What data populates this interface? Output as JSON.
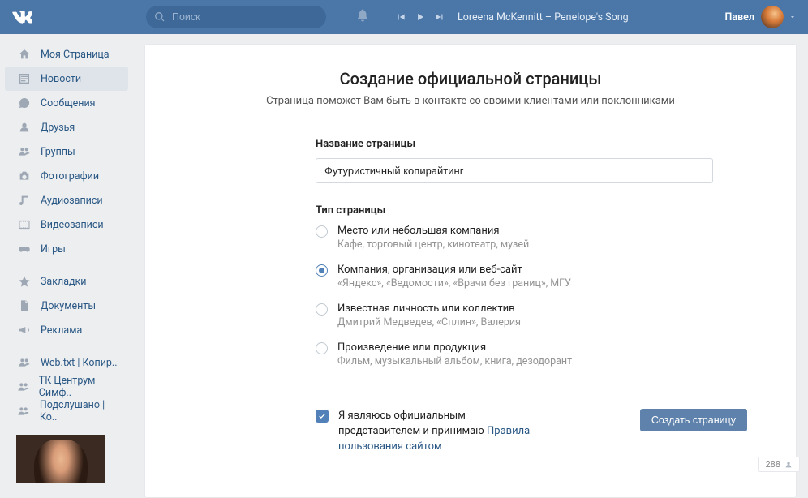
{
  "header": {
    "search_placeholder": "Поиск",
    "track": "Loreena McKennitt – Penelope's Song",
    "user_name": "Павел"
  },
  "sidebar": {
    "items": [
      {
        "label": "Моя Страница"
      },
      {
        "label": "Новости"
      },
      {
        "label": "Сообщения"
      },
      {
        "label": "Друзья"
      },
      {
        "label": "Группы"
      },
      {
        "label": "Фотографии"
      },
      {
        "label": "Аудиозаписи"
      },
      {
        "label": "Видеозаписи"
      },
      {
        "label": "Игры"
      }
    ],
    "items2": [
      {
        "label": "Закладки"
      },
      {
        "label": "Документы"
      },
      {
        "label": "Реклама"
      }
    ],
    "items3": [
      {
        "label": "Web.txt | Копир.."
      },
      {
        "label": "ТК Центрум Симф.."
      },
      {
        "label": "Подслушано | Ко.."
      }
    ]
  },
  "main": {
    "title": "Создание официальной страницы",
    "subtitle": "Страница поможет Вам быть в контакте со своими клиентами или поклонниками",
    "name_label": "Название страницы",
    "name_value": "Футуристичный копирайтинг",
    "type_label": "Тип страницы",
    "options": [
      {
        "title": "Место или небольшая компания",
        "desc": "Кафе, торговый центр, кинотеатр, музей"
      },
      {
        "title": "Компания, организация или веб-сайт",
        "desc": "«Яндекс», «Ведомости», «Врачи без границ», МГУ"
      },
      {
        "title": "Известная личность или коллектив",
        "desc": "Дмитрий Медведев, «Сплин», Валерия"
      },
      {
        "title": "Произведение или продукция",
        "desc": "Фильм, музыкальный альбом, книга, дезодорант"
      }
    ],
    "agree_prefix": "Я являюсь официальным представителем и принимаю ",
    "agree_link": "Правила пользования сайтом",
    "submit": "Создать страницу"
  },
  "online_count": "288"
}
